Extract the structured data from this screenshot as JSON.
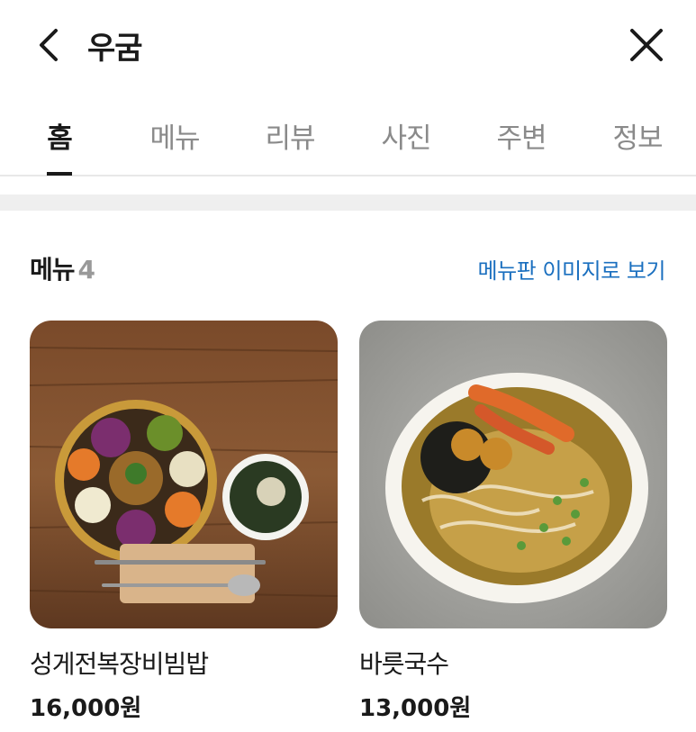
{
  "header": {
    "title": "우굼",
    "back_icon": "chevron-left-icon",
    "close_icon": "close-icon"
  },
  "tabs": [
    {
      "label": "홈",
      "active": true
    },
    {
      "label": "메뉴",
      "active": false
    },
    {
      "label": "리뷰",
      "active": false
    },
    {
      "label": "사진",
      "active": false
    },
    {
      "label": "주변",
      "active": false
    },
    {
      "label": "정보",
      "active": false
    }
  ],
  "menu_section": {
    "heading": "메뉴",
    "count": "4",
    "board_link": "메뉴판 이미지로 보기",
    "items": [
      {
        "name": "성게전복장비빔밥",
        "price": "16,000원"
      },
      {
        "name": "바릇국수",
        "price": "13,000원"
      }
    ]
  },
  "colors": {
    "link": "#1a6fbf",
    "text": "#1a1a1a",
    "inactive_tab": "#8a8a8a",
    "divider": "#efefef"
  }
}
